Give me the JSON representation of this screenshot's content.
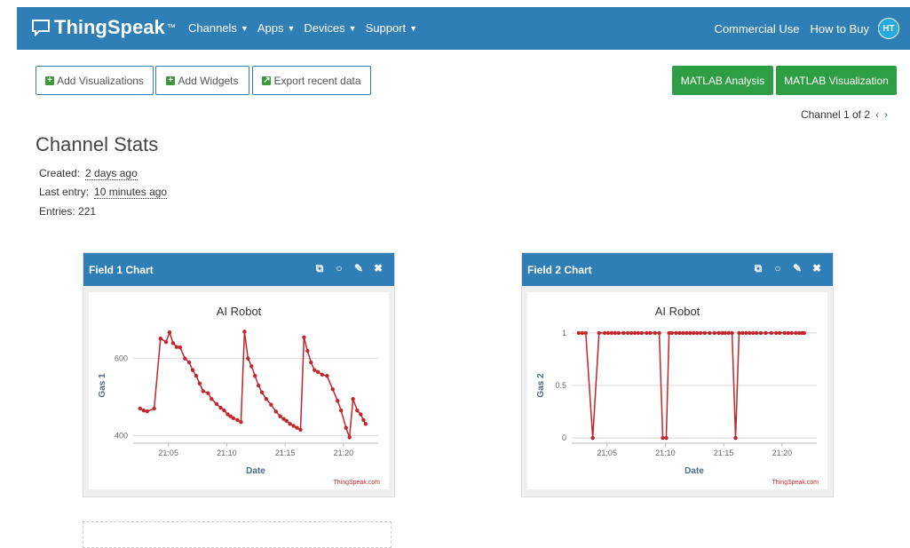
{
  "nav": {
    "brand": "ThingSpeak",
    "tm": "™",
    "menu": [
      {
        "label": "Channels"
      },
      {
        "label": "Apps"
      },
      {
        "label": "Devices"
      },
      {
        "label": "Support"
      }
    ],
    "commercial": "Commercial Use",
    "how_to_buy": "How to Buy",
    "avatar_initials": "HT"
  },
  "toolbar": {
    "add_visualizations": "Add Visualizations",
    "add_widgets": "Add Widgets",
    "export": "Export recent data",
    "matlab_analysis": "MATLAB Analysis",
    "matlab_visualization": "MATLAB Visualization"
  },
  "pager": {
    "text": "Channel 1 of 2"
  },
  "stats": {
    "title": "Channel Stats",
    "created_label": "Created:",
    "created_value": "2 days ago",
    "last_entry_label": "Last entry:",
    "last_entry_value": "10 minutes ago",
    "entries_text": "Entries: 221"
  },
  "colors": {
    "header_blue": "#2f7fb6",
    "green": "#2e9e44",
    "series": "#c0262b"
  },
  "icons": [
    "chat-bubble-icon",
    "external-link-icon",
    "comment-icon",
    "pencil-icon",
    "close-icon"
  ],
  "chart_data": [
    {
      "panel_title": "Field 1 Chart",
      "type": "line",
      "title": "AI Robot",
      "xlabel": "Date",
      "ylabel": "Gas 1",
      "credit": "ThingSpeak.com",
      "x_ticks": [
        "21:05",
        "21:10",
        "21:15",
        "21:20"
      ],
      "y_ticks": [
        400,
        600
      ],
      "xlim": [
        21.033,
        21.383
      ],
      "ylim": [
        380,
        680
      ],
      "grid": true,
      "series": [
        {
          "x": [
            21.043,
            21.048,
            21.053,
            21.063,
            21.072,
            21.08,
            21.085,
            21.09,
            21.095,
            21.1,
            21.107,
            21.113,
            21.118,
            21.123,
            21.128,
            21.133,
            21.14,
            21.145,
            21.152,
            21.158,
            21.163,
            21.168,
            21.172,
            21.176,
            21.182,
            21.187,
            21.192,
            21.197,
            21.202,
            21.207,
            21.212,
            21.217,
            21.223,
            21.23,
            21.237,
            21.243,
            21.248,
            21.252,
            21.257,
            21.262,
            21.267,
            21.272,
            21.277,
            21.282,
            21.287,
            21.292,
            21.297,
            21.303,
            21.31,
            21.318,
            21.325,
            21.33,
            21.337,
            21.342,
            21.347,
            21.353,
            21.358,
            21.362,
            21.365
          ],
          "y": [
            470,
            465,
            463,
            470,
            652,
            643,
            668,
            640,
            630,
            629,
            600,
            590,
            570,
            555,
            535,
            515,
            510,
            495,
            482,
            472,
            465,
            455,
            450,
            445,
            440,
            435,
            670,
            600,
            580,
            555,
            530,
            512,
            495,
            480,
            462,
            450,
            443,
            438,
            430,
            425,
            420,
            415,
            655,
            620,
            590,
            570,
            565,
            558,
            555,
            520,
            490,
            465,
            420,
            395,
            495,
            465,
            455,
            440,
            430
          ]
        }
      ]
    },
    {
      "panel_title": "Field 2 Chart",
      "type": "line",
      "title": "AI Robot",
      "xlabel": "Date",
      "ylabel": "Gas 2",
      "credit": "ThingSpeak.com",
      "x_ticks": [
        "21:05",
        "21:10",
        "21:15",
        "21:20"
      ],
      "y_ticks": [
        0,
        0.5,
        1
      ],
      "xlim": [
        21.033,
        21.383
      ],
      "ylim": [
        -0.05,
        1.05
      ],
      "grid": true,
      "series": [
        {
          "x": [
            21.043,
            21.048,
            21.053,
            21.063,
            21.072,
            21.08,
            21.085,
            21.09,
            21.095,
            21.1,
            21.107,
            21.113,
            21.118,
            21.123,
            21.128,
            21.133,
            21.14,
            21.145,
            21.152,
            21.158,
            21.163,
            21.168,
            21.172,
            21.176,
            21.182,
            21.187,
            21.192,
            21.197,
            21.202,
            21.207,
            21.212,
            21.217,
            21.223,
            21.23,
            21.237,
            21.243,
            21.248,
            21.252,
            21.257,
            21.262,
            21.267,
            21.272,
            21.277,
            21.282,
            21.287,
            21.292,
            21.297,
            21.303,
            21.31,
            21.318,
            21.325,
            21.33,
            21.337,
            21.342,
            21.347,
            21.353,
            21.358,
            21.362,
            21.365
          ],
          "y": [
            1,
            1,
            1,
            0,
            1,
            1,
            1,
            1,
            1,
            1,
            1,
            1,
            1,
            1,
            1,
            1,
            1,
            1,
            1,
            1,
            0,
            0,
            1,
            1,
            1,
            1,
            1,
            1,
            1,
            1,
            1,
            1,
            1,
            1,
            1,
            1,
            1,
            1,
            1,
            1,
            0,
            1,
            1,
            1,
            1,
            1,
            1,
            1,
            1,
            1,
            1,
            1,
            1,
            1,
            1,
            1,
            1,
            1,
            1
          ]
        }
      ]
    }
  ]
}
